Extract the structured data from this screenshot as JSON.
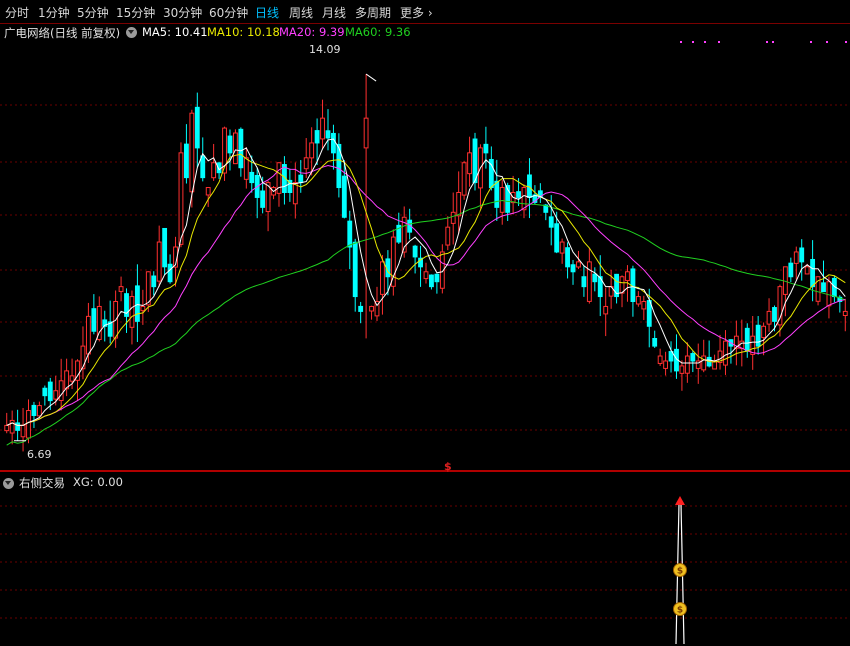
{
  "tabs": [
    "分时",
    "1分钟",
    "5分钟",
    "15分钟",
    "30分钟",
    "60分钟",
    "日线",
    "周线",
    "月线",
    "多周期",
    "更多"
  ],
  "active_tab": "日线",
  "main_title": "广电网络(日线 前复权)",
  "ma_labels": [
    {
      "text": "MA5: 10.41",
      "color": "#ffffff"
    },
    {
      "text": "MA10: 10.18",
      "color": "#e8e800"
    },
    {
      "text": "MA20: 9.39",
      "color": "#ff40ff"
    },
    {
      "text": "MA60: 9.36",
      "color": "#20d020"
    }
  ],
  "high_label": "14.09",
  "low_label": "6.69",
  "dollar_mark": "$",
  "indicator_title": "右侧交易",
  "indicator_value": "XG: 0.00",
  "colors": {
    "up": "#ff3030",
    "down": "#00ffff",
    "ma5": "#ffffff",
    "ma10": "#e8e800",
    "ma20": "#ff40ff",
    "ma60": "#20d020",
    "grid": "#6a0000",
    "marker": "#ff40ff"
  },
  "chart_data": {
    "type": "candlestick",
    "price_range": [
      6.1,
      15.1
    ],
    "extreme_labels": {
      "high": 14.09,
      "low": 6.69
    },
    "ma_values": {
      "MA5": 10.41,
      "MA10": 10.18,
      "MA20": 9.39,
      "MA60": 9.36
    },
    "close": [
      7.0,
      7.1,
      6.9,
      7.0,
      7.3,
      7.2,
      7.4,
      7.6,
      7.5,
      7.7,
      7.9,
      8.1,
      8.0,
      8.3,
      8.6,
      9.2,
      8.9,
      9.4,
      9.0,
      8.8,
      9.5,
      9.8,
      9.2,
      9.6,
      9.1,
      9.4,
      10.1,
      9.8,
      10.7,
      10.2,
      9.9,
      10.6,
      12.5,
      12.0,
      13.3,
      12.6,
      12.0,
      11.8,
      12.3,
      12.1,
      13.0,
      12.5,
      12.9,
      12.2,
      12.4,
      11.9,
      11.6,
      11.4,
      11.9,
      11.8,
      12.3,
      11.7,
      11.7,
      11.9,
      11.9,
      12.4,
      12.7,
      12.7,
      13.2,
      12.8,
      12.5,
      11.8,
      11.2,
      10.6,
      9.6,
      9.3,
      9.3,
      9.4,
      9.5,
      10.3,
      10.0,
      10.8,
      10.7,
      11.2,
      10.9,
      10.4,
      10.2,
      10.1,
      9.8,
      9.9,
      10.5,
      11.0,
      11.3,
      11.7,
      12.3,
      12.5,
      11.9,
      12.6,
      12.5,
      11.8,
      11.4,
      11.8,
      11.3,
      11.7,
      11.6,
      11.8,
      11.6,
      11.5,
      11.6,
      11.3,
      11.0,
      10.5,
      10.7,
      10.2,
      10.1,
      10.3,
      9.8,
      10.3,
      9.9,
      9.6,
      9.4,
      9.8,
      9.6,
      10.0,
      10.1,
      9.5,
      9.6,
      9.5,
      9.0,
      8.6,
      8.4,
      8.3,
      8.3,
      8.1,
      8.2,
      8.4,
      8.3,
      8.3,
      8.4,
      8.2,
      8.3,
      8.5,
      8.7,
      8.6,
      8.8,
      8.7,
      8.5,
      8.8,
      8.6,
      9.0,
      9.3,
      9.1,
      9.8,
      10.2,
      10.0,
      10.5,
      10.3,
      10.2,
      9.8,
      10.0,
      9.7,
      9.9,
      9.6,
      9.5,
      9.3
    ],
    "bottom_indicator": {
      "name": "右侧交易",
      "XG": 0.0,
      "signal_index": 132
    }
  }
}
